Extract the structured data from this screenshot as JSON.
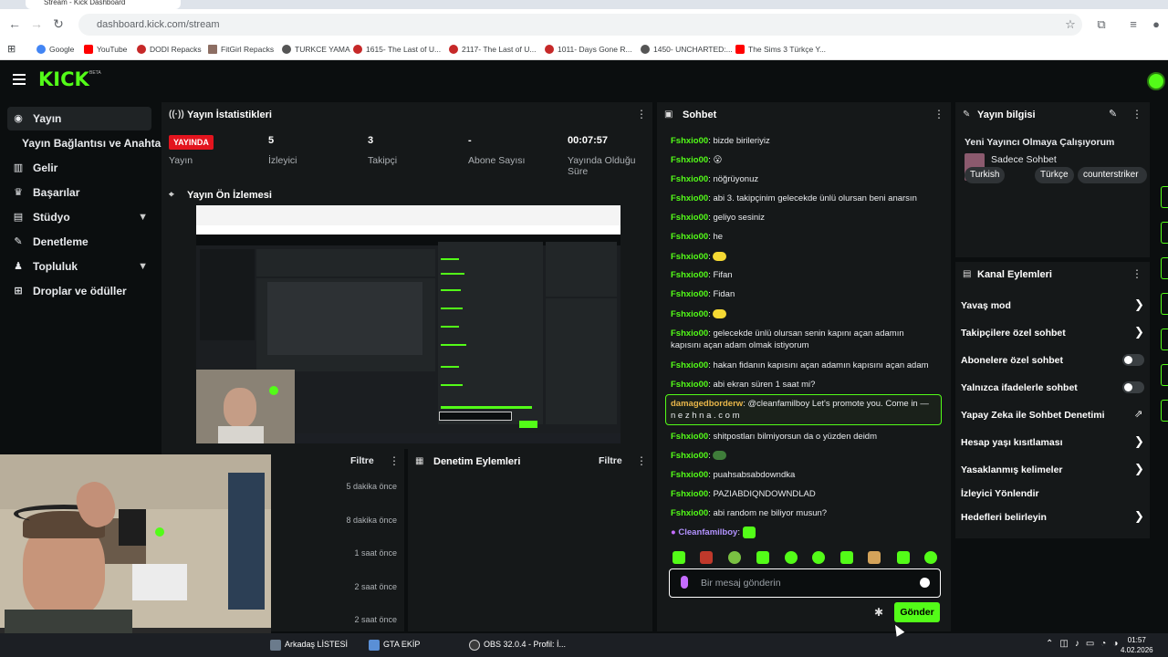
{
  "browser": {
    "tab_title": "Stream - Kick Dashboard",
    "url": "dashboard.kick.com/stream",
    "bookmarks": [
      {
        "label": "Google",
        "color": "#4285f4"
      },
      {
        "label": "YouTube",
        "color": "#ff0000"
      },
      {
        "label": "DODI Repacks",
        "color": "#c62828"
      },
      {
        "label": "FitGirl Repacks",
        "color": "#8d6e63"
      },
      {
        "label": "TURKCE YAMA",
        "color": "#555555"
      },
      {
        "label": "1615- The Last of U...",
        "color": "#c62828"
      },
      {
        "label": "2117- The Last of U...",
        "color": "#c62828"
      },
      {
        "label": "1011- Days Gone R...",
        "color": "#c62828"
      },
      {
        "label": "1450- UNCHARTED:...",
        "color": "#555555"
      },
      {
        "label": "The Sims 3 Türkçe Y...",
        "color": "#ff0000"
      }
    ]
  },
  "header": {
    "logo": "KICK",
    "beta": "BETA"
  },
  "sidebar": {
    "items": [
      {
        "label": "Yayın",
        "icon": "broadcast-icon"
      },
      {
        "label": "Yayın Bağlantısı ve Anahtarı",
        "icon": ""
      },
      {
        "label": "Gelir",
        "icon": "chart-icon"
      },
      {
        "label": "Başarılar",
        "icon": "trophy-icon"
      },
      {
        "label": "Stüdyo",
        "icon": "studio-icon"
      },
      {
        "label": "Denetleme",
        "icon": "wrench-icon"
      },
      {
        "label": "Topluluk",
        "icon": "community-icon"
      },
      {
        "label": "Droplar ve ödüller",
        "icon": "gift-icon"
      }
    ]
  },
  "stats": {
    "title": "Yayın İstatistikleri",
    "live_badge": "YAYINDA",
    "items": [
      {
        "value": "",
        "label": "Yayın"
      },
      {
        "value": "5",
        "label": "İzleyici"
      },
      {
        "value": "3",
        "label": "Takipçi"
      },
      {
        "value": "-",
        "label": "Abone Sayısı"
      },
      {
        "value": "00:07:57",
        "label": "Yayında Olduğu Süre"
      }
    ]
  },
  "preview": {
    "title": "Yayın Ön İzlemesi"
  },
  "activity": {
    "filter_label": "Filtre",
    "times": [
      "5 dakika önce",
      "8 dakika önce",
      "1 saat önce",
      "2 saat önce",
      "2 saat önce"
    ]
  },
  "moderation": {
    "title": "Denetim Eylemleri",
    "filter_label": "Filtre"
  },
  "chat": {
    "title": "Sohbet",
    "messages": [
      {
        "user": "Fshxio00",
        "text": "bizde birileriyiz"
      },
      {
        "user": "Fshxio00",
        "text": "😮"
      },
      {
        "user": "Fshxio00",
        "text": "nöğrüyonuz"
      },
      {
        "user": "Fshxio00",
        "text": "abi 3. takipçinim gelecekde ünlü olursan beni anarsın"
      },
      {
        "user": "Fshxio00",
        "text": "geliyo sesiniz"
      },
      {
        "user": "Fshxio00",
        "text": "he"
      },
      {
        "user": "Fshxio00",
        "text": ""
      },
      {
        "user": "Fshxio00",
        "text": "Fifan"
      },
      {
        "user": "Fshxio00",
        "text": "Fidan"
      },
      {
        "user": "Fshxio00",
        "text": ""
      },
      {
        "user": "Fshxio00",
        "text": "gelecekde ünlü olursan senin kapını açan adamın kapısını açan adam olmak istiyorum"
      },
      {
        "user": "Fshxio00",
        "text": "hakan fidanın kapısını açan adamın kapısını açan adam"
      },
      {
        "user": "Fshxio00",
        "text": "abi ekran süren 1 saat mi?"
      },
      {
        "user": "damagedborderw",
        "text": "@cleanfamilboy Let's promote you. Come in — n e z h n a . c o m"
      },
      {
        "user": "Fshxio00",
        "text": "shitpostları bilmiyorsun da o yüzden deidm"
      },
      {
        "user": "Fshxio00",
        "text": ""
      },
      {
        "user": "Fshxio00",
        "text": "puahsabsabdowndka"
      },
      {
        "user": "Fshxio00",
        "text": "PAZIABDIQNDOWNDLAD"
      },
      {
        "user": "Fshxio00",
        "text": "abi random ne biliyor musun?"
      },
      {
        "user": "Cleanfamilboy",
        "text": ""
      }
    ],
    "input_placeholder": "Bir mesaj gönderin",
    "send_label": "Gönder"
  },
  "stream_info": {
    "title": "Yayın bilgisi",
    "stream_title": "Yeni Yayıncı Olmaya Çalışıyorum",
    "category": "Sadece Sohbet",
    "tags": [
      "Turkish",
      "Türkçe",
      "counterstriker"
    ]
  },
  "channel_actions": {
    "title": "Kanal Eylemleri",
    "items": [
      {
        "label": "Yavaş mod",
        "control": "arrow"
      },
      {
        "label": "Takipçilere özel sohbet",
        "control": "arrow"
      },
      {
        "label": "Abonelere özel sohbet",
        "control": "toggle"
      },
      {
        "label": "Yalnızca ifadelerle sohbet",
        "control": "toggle"
      },
      {
        "label": "Yapay Zeka ile Sohbet Denetimi",
        "control": "external"
      },
      {
        "label": "Hesap yaşı kısıtlaması",
        "control": "arrow"
      },
      {
        "label": "Yasaklanmış kelimeler",
        "control": "arrow"
      },
      {
        "label": "İzleyici Yönlendir",
        "control": "none"
      },
      {
        "label": "Hedefleri belirleyin",
        "control": "arrow"
      }
    ]
  },
  "taskbar": {
    "items": [
      "Arkadaş LİSTESİ",
      "GTA EKİP",
      "OBS 32.0.4 - Profil: İ..."
    ],
    "time": "01:57",
    "date": "4.02.2026"
  }
}
